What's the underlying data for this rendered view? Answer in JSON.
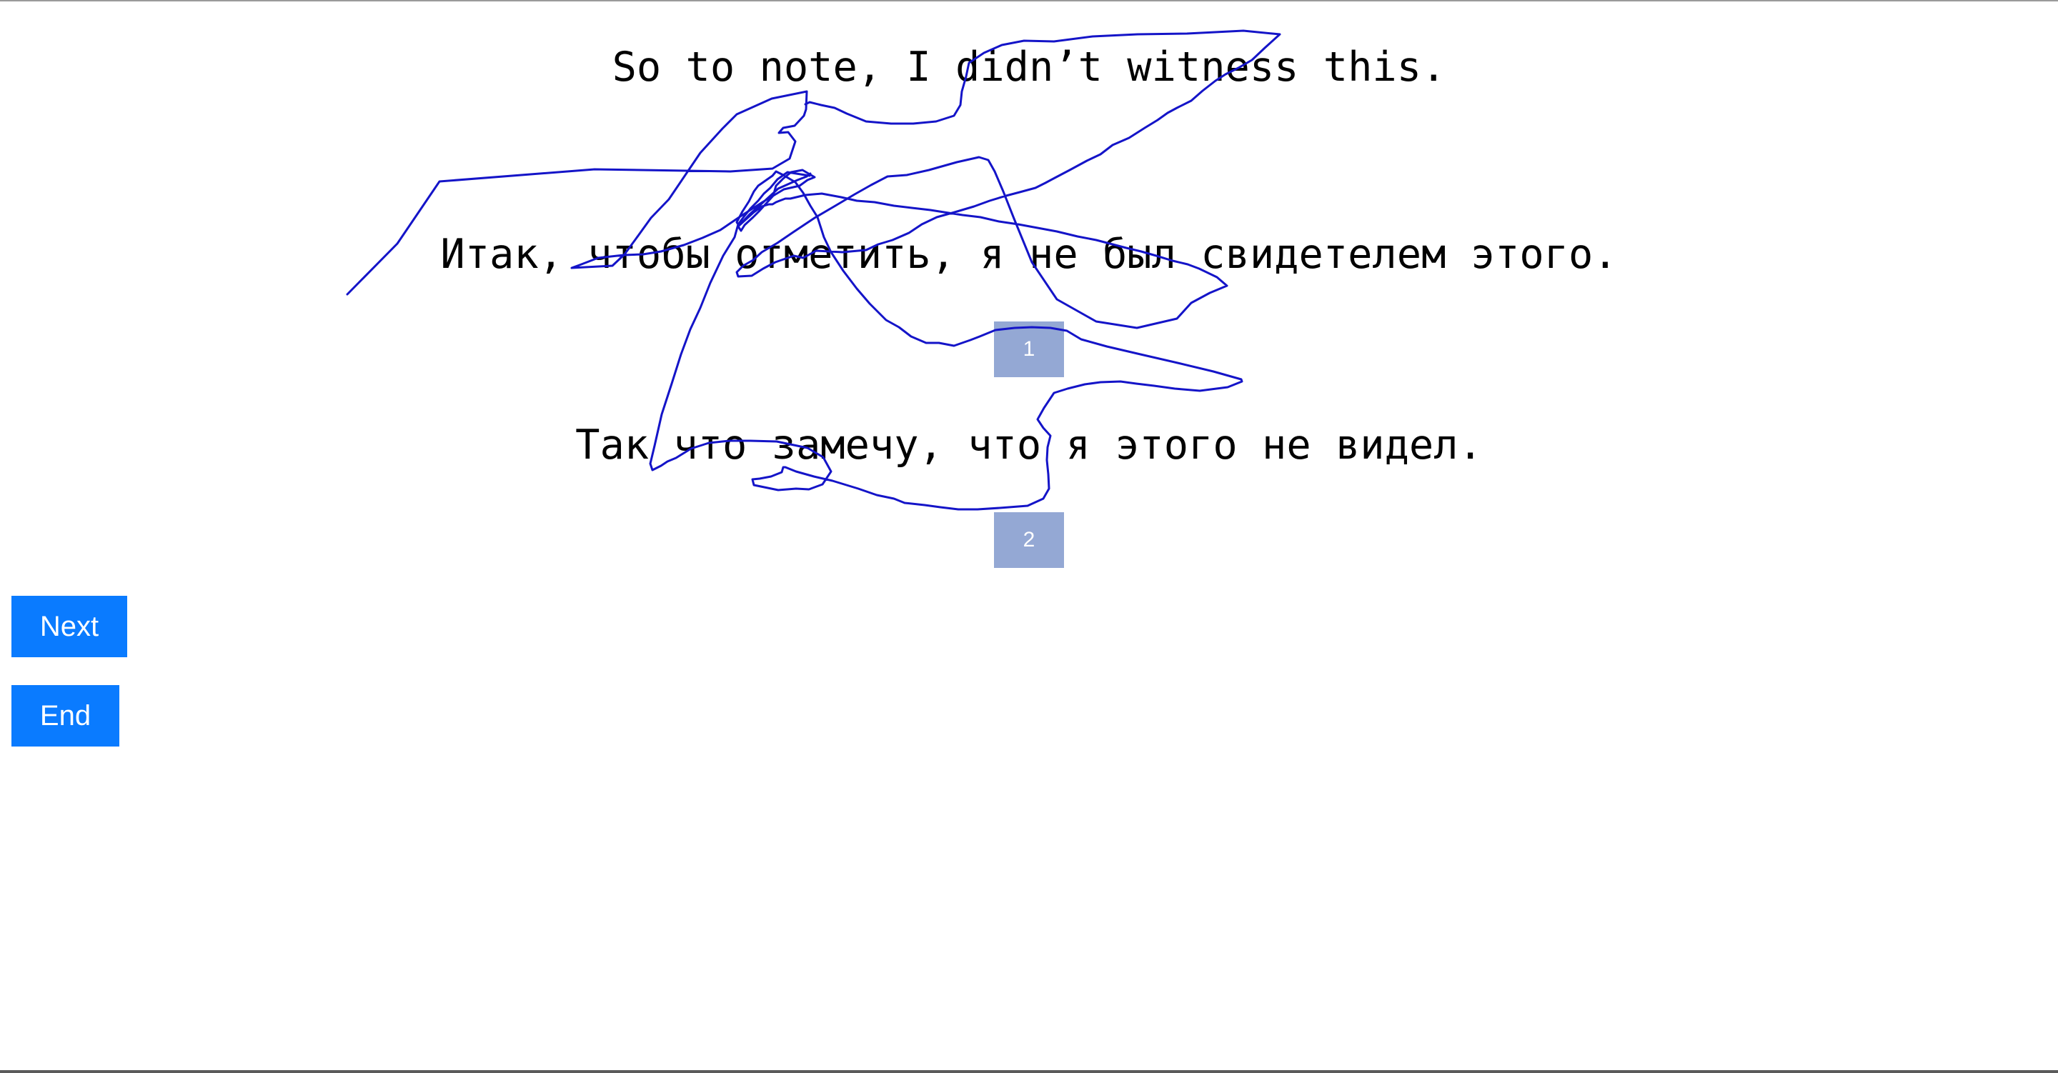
{
  "source_sentence": "So to note, I didn’t witness this.",
  "translations": [
    {
      "number": "1",
      "text": "Итак, чтобы отметить, я не был свидетелем этого."
    },
    {
      "number": "2",
      "text": "Так что замечу, что я этого не видел."
    }
  ],
  "buttons": {
    "next_label": "Next",
    "end_label": "End"
  },
  "colors": {
    "button_blue": "#0a7bff",
    "badge_blue": "#94a8d4",
    "scribble_stroke": "#1414c8"
  }
}
